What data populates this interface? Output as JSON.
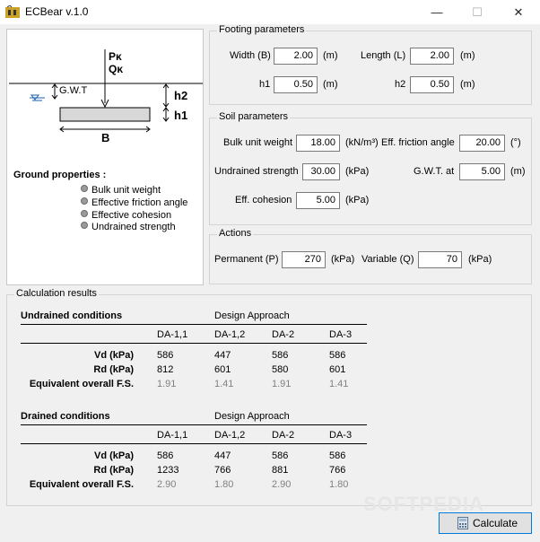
{
  "window": {
    "title": "ECBear v.1.0",
    "min_glyph": "—",
    "max_glyph": "☐",
    "close_glyph": "✕"
  },
  "diagram": {
    "load_p": "Pκ",
    "load_q": "Qκ",
    "gwt_label": "G.W.T",
    "h2": "h2",
    "h1": "h1",
    "b": "B",
    "ground_title": "Ground properties :",
    "ground_items": [
      "Bulk unit weight",
      "Effective friction angle",
      "Effective cohesion",
      "Undrained strength"
    ]
  },
  "footing": {
    "title": "Footing parameters",
    "width_label": "Width (B)",
    "width_value": "2.00",
    "width_unit": "(m)",
    "length_label": "Length (L)",
    "length_value": "2.00",
    "length_unit": "(m)",
    "h1_label": "h1",
    "h1_value": "0.50",
    "h1_unit": "(m)",
    "h2_label": "h2",
    "h2_value": "0.50",
    "h2_unit": "(m)"
  },
  "soil": {
    "title": "Soil parameters",
    "bulk_label": "Bulk unit weight",
    "bulk_value": "18.00",
    "bulk_unit": "(kN/m³)",
    "friction_label": "Eff. friction angle",
    "friction_value": "20.00",
    "friction_unit": "(°)",
    "undrained_label": "Undrained strength",
    "undrained_value": "30.00",
    "undrained_unit": "(kPa)",
    "gwt_label": "G.W.T. at",
    "gwt_value": "5.00",
    "gwt_unit": "(m)",
    "cohesion_label": "Eff. cohesion",
    "cohesion_value": "5.00",
    "cohesion_unit": "(kPa)"
  },
  "actions": {
    "title": "Actions",
    "permanent_label": "Permanent (P)",
    "permanent_value": "270",
    "permanent_unit": "(kPa)",
    "variable_label": "Variable (Q)",
    "variable_value": "70",
    "variable_unit": "(kPa)"
  },
  "results": {
    "title": "Calculation results",
    "design_approach": "Design Approach",
    "columns": [
      "DA-1,1",
      "DA-1,2",
      "DA-2",
      "DA-3"
    ],
    "undrained": {
      "title": "Undrained conditions",
      "rows": [
        {
          "label": "Vd (kPa)",
          "values": [
            "586",
            "447",
            "586",
            "586"
          ]
        },
        {
          "label": "Rd (kPa)",
          "values": [
            "812",
            "601",
            "580",
            "601"
          ]
        },
        {
          "label": "Equivalent overall F.S.",
          "values": [
            "1.91",
            "1.41",
            "1.91",
            "1.41"
          ]
        }
      ]
    },
    "drained": {
      "title": "Drained conditions",
      "rows": [
        {
          "label": "Vd (kPa)",
          "values": [
            "586",
            "447",
            "586",
            "586"
          ]
        },
        {
          "label": "Rd (kPa)",
          "values": [
            "1233",
            "766",
            "881",
            "766"
          ]
        },
        {
          "label": "Equivalent overall F.S.",
          "values": [
            "2.90",
            "1.80",
            "2.90",
            "1.80"
          ]
        }
      ]
    }
  },
  "calculate_label": "Calculate",
  "watermark": "SOFTPEDIA"
}
